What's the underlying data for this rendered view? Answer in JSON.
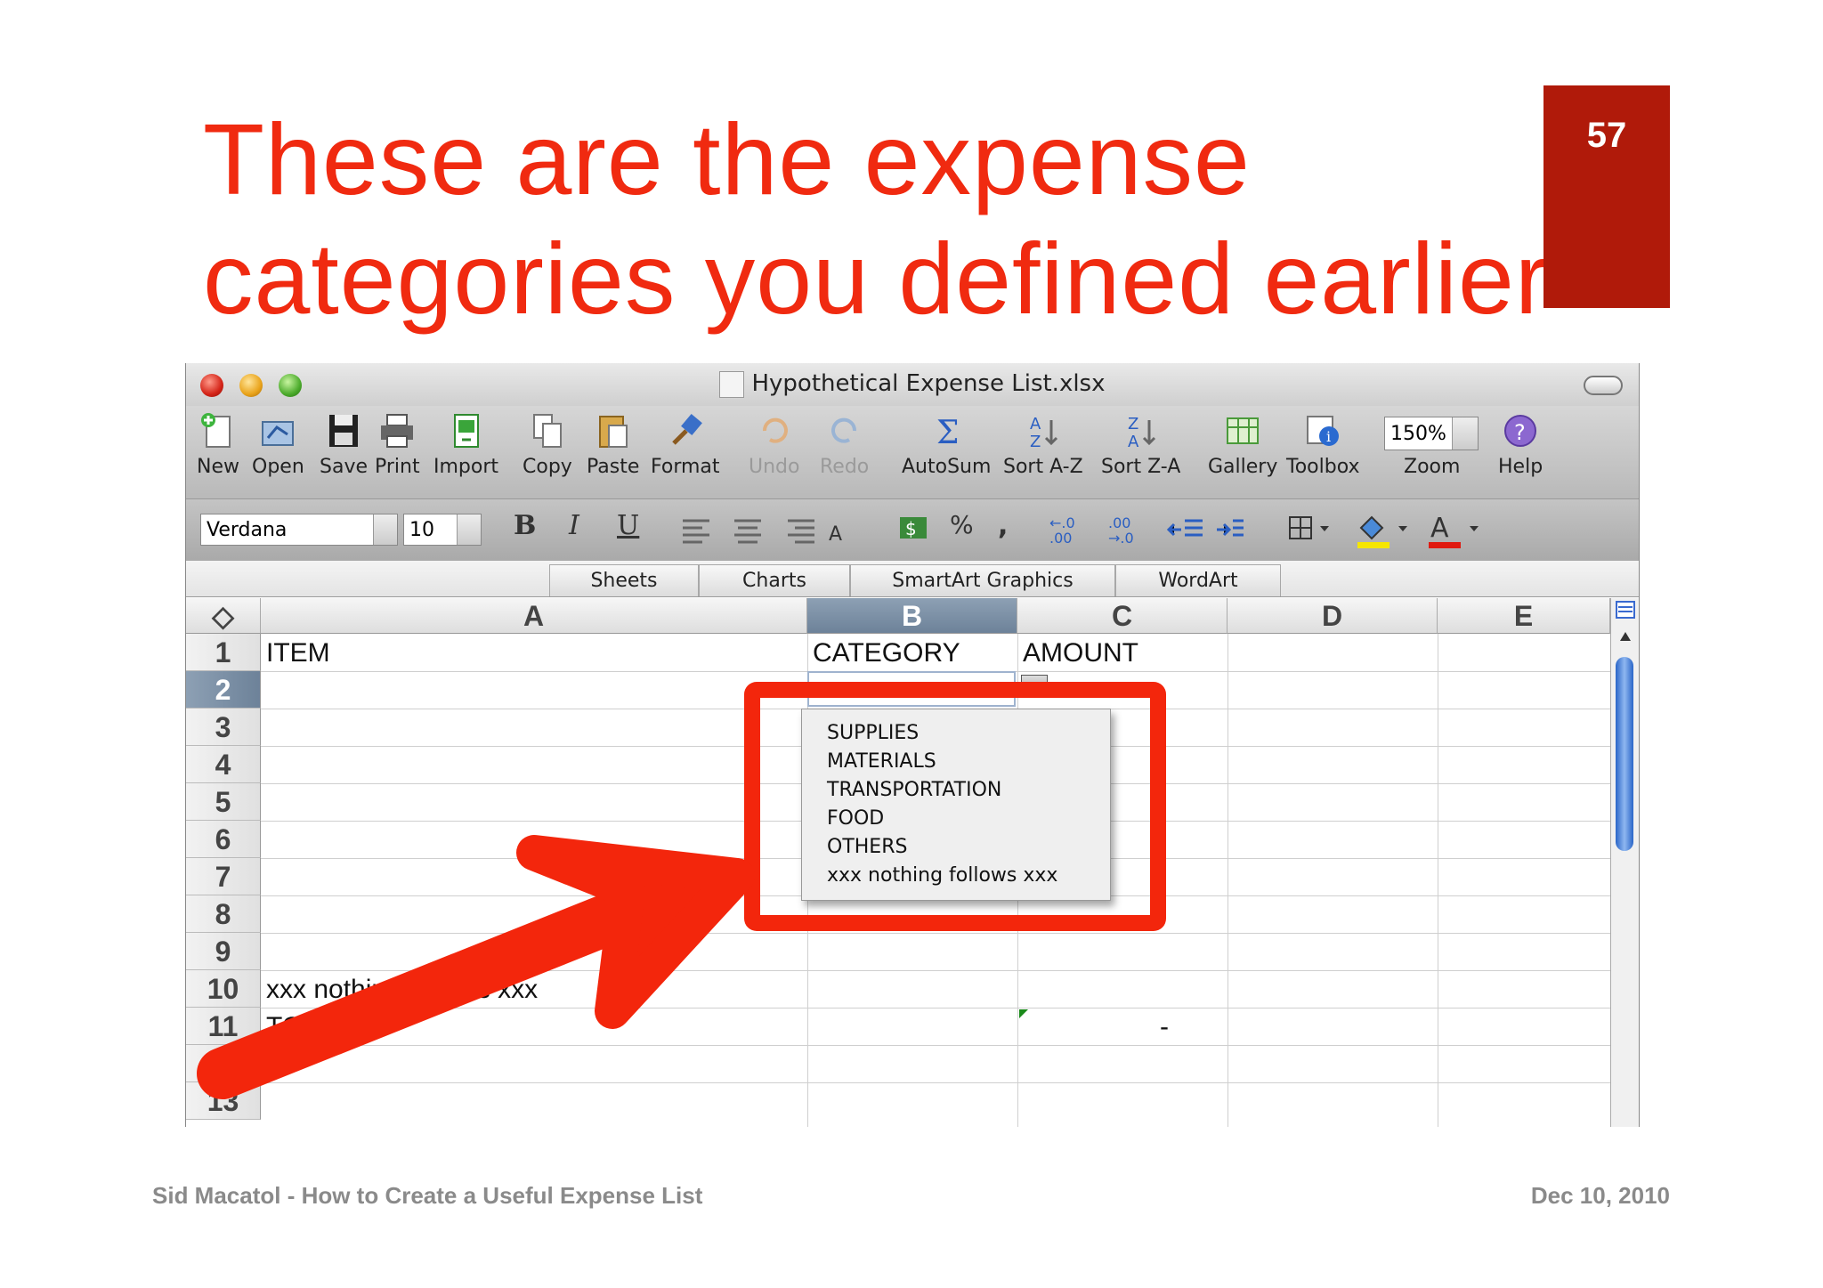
{
  "slide": {
    "title_line1": "These are the expense",
    "title_line2": "categories you defined earlier",
    "page_number": "57",
    "footer_left": "Sid Macatol - How to Create a Useful Expense List",
    "footer_right": "Dec 10, 2010",
    "colors": {
      "title": "#f02a10",
      "badge": "#b01a0a",
      "highlight": "#f3260c"
    }
  },
  "window": {
    "title": "Hypothetical Expense List.xlsx"
  },
  "toolbar": {
    "items": [
      {
        "label": "New",
        "icon": "new-document-icon"
      },
      {
        "label": "Open",
        "icon": "open-folder-icon"
      },
      {
        "label": "Save",
        "icon": "save-disk-icon"
      },
      {
        "label": "Print",
        "icon": "printer-icon"
      },
      {
        "label": "Import",
        "icon": "import-icon"
      },
      {
        "label": "Copy",
        "icon": "copy-icon"
      },
      {
        "label": "Paste",
        "icon": "paste-icon"
      },
      {
        "label": "Format",
        "icon": "format-brush-icon"
      },
      {
        "label": "Undo",
        "icon": "undo-icon"
      },
      {
        "label": "Redo",
        "icon": "redo-icon"
      },
      {
        "label": "AutoSum",
        "icon": "sigma-icon"
      },
      {
        "label": "Sort A-Z",
        "icon": "sort-ascending-icon"
      },
      {
        "label": "Sort Z-A",
        "icon": "sort-descending-icon"
      },
      {
        "label": "Gallery",
        "icon": "gallery-icon"
      },
      {
        "label": "Toolbox",
        "icon": "toolbox-icon"
      },
      {
        "label": "Zoom",
        "icon": "zoom-icon"
      },
      {
        "label": "Help",
        "icon": "help-icon"
      }
    ],
    "zoom_value": "150%"
  },
  "formatting": {
    "font_name": "Verdana",
    "font_size": "10",
    "bold": "B",
    "italic": "I",
    "underline": "U",
    "percent": "%",
    "comma": ",",
    "inc_decimal": "←.0 .00",
    "dec_decimal": ".00 →.0"
  },
  "ribbon": {
    "tabs": [
      "Sheets",
      "Charts",
      "SmartArt Graphics",
      "WordArt"
    ]
  },
  "sheet": {
    "columns": [
      "A",
      "B",
      "C",
      "D",
      "E"
    ],
    "rows": [
      "1",
      "2",
      "3",
      "4",
      "5",
      "6",
      "7",
      "8",
      "9",
      "10",
      "11",
      "12",
      "13"
    ],
    "cells": {
      "A1": "ITEM",
      "B1": "CATEGORY",
      "C1": "AMOUNT",
      "A10": "xxx nothing follows xxx",
      "A11": "TOTAL",
      "C11": "-"
    },
    "dropdown_options": [
      "SUPPLIES",
      "MATERIALS",
      "TRANSPORTATION",
      "FOOD",
      "OTHERS",
      "xxx nothing follows xxx"
    ]
  }
}
